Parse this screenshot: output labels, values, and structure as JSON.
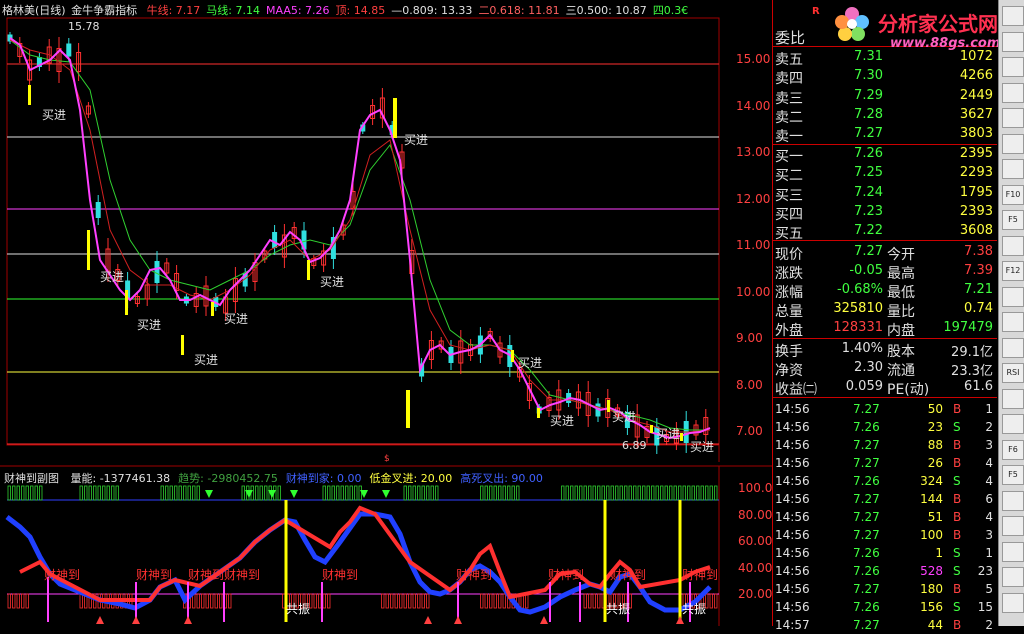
{
  "price_header": {
    "title": "格林美(日线)",
    "indicator": "金牛争霸指标",
    "items": [
      {
        "label": "牛线: 7.17",
        "color": "#ff4040"
      },
      {
        "label": "马线: 7.14",
        "color": "#40ff40"
      },
      {
        "label": "MAA5: 7.26",
        "color": "#ff40ff"
      },
      {
        "label": "顶: 14.85",
        "color": "#ff4040"
      },
      {
        "label": "—0.809: 13.33",
        "color": "#e0e0e0"
      },
      {
        "label": "二0.618: 11.81",
        "color": "#ff6060"
      },
      {
        "label": "三0.500: 10.87",
        "color": "#e0e0e0"
      },
      {
        "label": "四0.3€",
        "color": "#40ff40"
      }
    ]
  },
  "price_axis": [
    "15.00",
    "14.00",
    "13.00",
    "12.00",
    "11.00",
    "10.00",
    "9.00",
    "8.00",
    "7.00"
  ],
  "price_annotations": {
    "high": "15.78",
    "low": "6.89",
    "buy": "买进",
    "marker": "$"
  },
  "indicator_header": {
    "title": "财神到副图",
    "items": [
      {
        "label": "量能: -1377461.38",
        "color": "#e0e0e0"
      },
      {
        "label": "趋势: -2980452.75",
        "color": "#40a040"
      },
      {
        "label": "财神到家: 0.00",
        "color": "#4060ff"
      },
      {
        "label": "低金叉进: 20.00",
        "color": "#ffff40"
      },
      {
        "label": "高死叉出: 90.00",
        "color": "#4060ff"
      }
    ]
  },
  "indicator_axis": [
    "100.0",
    "80.00",
    "60.00",
    "40.00",
    "20.00"
  ],
  "indicator_labels": {
    "caishen": "财神到",
    "gongzhen": "共振"
  },
  "quote": {
    "weibi_label": "委比",
    "sell": [
      {
        "name": "卖五",
        "price": "7.31",
        "vol": "1072"
      },
      {
        "name": "卖四",
        "price": "7.30",
        "vol": "4266"
      },
      {
        "name": "卖三",
        "price": "7.29",
        "vol": "2449"
      },
      {
        "name": "卖二",
        "price": "7.28",
        "vol": "3627"
      },
      {
        "name": "卖一",
        "price": "7.27",
        "vol": "3803"
      }
    ],
    "buy": [
      {
        "name": "买一",
        "price": "7.26",
        "vol": "2395"
      },
      {
        "name": "买二",
        "price": "7.25",
        "vol": "2293"
      },
      {
        "name": "买三",
        "price": "7.24",
        "vol": "1795"
      },
      {
        "name": "买四",
        "price": "7.23",
        "vol": "2393"
      },
      {
        "name": "买五",
        "price": "7.22",
        "vol": "3608"
      }
    ],
    "stats": [
      {
        "n1": "现价",
        "v1": "7.27",
        "c1": "#40ff40",
        "n2": "今开",
        "v2": "7.38",
        "c2": "#ff4040"
      },
      {
        "n1": "涨跌",
        "v1": "-0.05",
        "c1": "#40ff40",
        "n2": "最高",
        "v2": "7.39",
        "c2": "#ff4040"
      },
      {
        "n1": "涨幅",
        "v1": "-0.68%",
        "c1": "#40ff40",
        "n2": "最低",
        "v2": "7.21",
        "c2": "#40ff40"
      },
      {
        "n1": "总量",
        "v1": "325810",
        "c1": "#ffff40",
        "n2": "量比",
        "v2": "0.74",
        "c2": "#ffff40"
      },
      {
        "n1": "外盘",
        "v1": "128331",
        "c1": "#ff4040",
        "n2": "内盘",
        "v2": "197479",
        "c2": "#40ff40"
      }
    ],
    "stats2": [
      {
        "n1": "换手",
        "v1": "1.40%",
        "c1": "#e0e0e0",
        "n2": "股本",
        "v2": "29.1亿",
        "c2": "#e0e0e0"
      },
      {
        "n1": "净资",
        "v1": "2.30",
        "c1": "#e0e0e0",
        "n2": "流通",
        "v2": "23.3亿",
        "c2": "#e0e0e0"
      },
      {
        "n1": "收益㈡",
        "v1": "0.059",
        "c1": "#e0e0e0",
        "n2": "PE(动)",
        "v2": "61.6",
        "c2": "#e0e0e0"
      }
    ],
    "ticks": [
      {
        "t": "14:56",
        "p": "7.27",
        "v": "50",
        "d": "B",
        "n": "1"
      },
      {
        "t": "14:56",
        "p": "7.26",
        "v": "23",
        "d": "S",
        "n": "2"
      },
      {
        "t": "14:56",
        "p": "7.27",
        "v": "88",
        "d": "B",
        "n": "3"
      },
      {
        "t": "14:56",
        "p": "7.27",
        "v": "26",
        "d": "B",
        "n": "4"
      },
      {
        "t": "14:56",
        "p": "7.26",
        "v": "324",
        "d": "S",
        "n": "4"
      },
      {
        "t": "14:56",
        "p": "7.27",
        "v": "144",
        "d": "B",
        "n": "6"
      },
      {
        "t": "14:56",
        "p": "7.27",
        "v": "51",
        "d": "B",
        "n": "4"
      },
      {
        "t": "14:56",
        "p": "7.27",
        "v": "100",
        "d": "B",
        "n": "3"
      },
      {
        "t": "14:56",
        "p": "7.26",
        "v": "1",
        "d": "S",
        "n": "1"
      },
      {
        "t": "14:56",
        "p": "7.26",
        "v": "528",
        "d": "S",
        "n": "23"
      },
      {
        "t": "14:56",
        "p": "7.27",
        "v": "180",
        "d": "B",
        "n": "5"
      },
      {
        "t": "14:56",
        "p": "7.26",
        "v": "156",
        "d": "S",
        "n": "15"
      },
      {
        "t": "14:57",
        "p": "7.27",
        "v": "44",
        "d": "B",
        "n": "2"
      }
    ]
  },
  "logo": {
    "text": "分析家公式网",
    "url": "www.88gs.com",
    "r": "R"
  },
  "toolbar": [
    "F10",
    "F5",
    "F12",
    "RSI",
    "F6",
    "F5"
  ]
}
